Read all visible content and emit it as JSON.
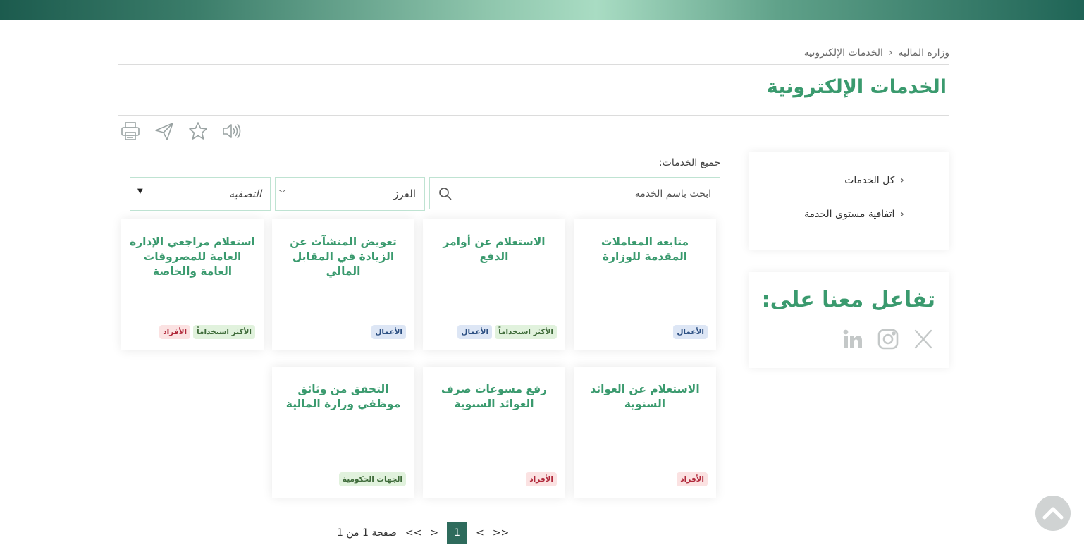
{
  "breadcrumb": {
    "home": "وزارة المالية",
    "current": "الخدمات الإلكترونية"
  },
  "page": {
    "title": "الخدمات الإلكترونية"
  },
  "tools": [
    "speaker-icon",
    "star-icon",
    "send-icon",
    "print-icon"
  ],
  "sidebar": {
    "items": [
      {
        "label": "كل الخدمات"
      },
      {
        "label": "اتفاقية مستوى الخدمة"
      }
    ]
  },
  "social": {
    "title": "تفاعل معنا على:",
    "icons": [
      "x-icon",
      "instagram-icon",
      "linkedin-icon"
    ]
  },
  "main": {
    "section_label": "جميع الخدمات:",
    "search_placeholder": "ابحث باسم الخدمة",
    "sort_label": "الفرز",
    "filter_label": "التصفيه"
  },
  "cards": [
    {
      "title": "متابعة المعاملات المقدمة للوزارة",
      "tags": [
        {
          "label": "الأعمال",
          "type": "business"
        }
      ]
    },
    {
      "title": "الاستعلام عن أوامر الدفع",
      "tags": [
        {
          "label": "الأكثر استخداماً",
          "type": "popular"
        },
        {
          "label": "الأعمال",
          "type": "business"
        }
      ]
    },
    {
      "title": "تعويض المنشآت عن الزيادة في المقابل المالي",
      "tags": [
        {
          "label": "الأعمال",
          "type": "business"
        }
      ]
    },
    {
      "title": "استعلام مراجعي الإدارة العامة للمصروفات العامة والخاصة",
      "tags": [
        {
          "label": "الأكثر استخداماً",
          "type": "popular"
        },
        {
          "label": "الأفراد",
          "type": "individuals"
        }
      ]
    },
    {
      "title": "الاستعلام عن العوائد السنوية",
      "tags": [
        {
          "label": "الأفراد",
          "type": "individuals"
        }
      ]
    },
    {
      "title": "رفع مسوغات صرف العوائد السنوية",
      "tags": [
        {
          "label": "الأفراد",
          "type": "individuals"
        }
      ]
    },
    {
      "title": "التحقق من وثائق موظفي وزارة المالية",
      "tags": [
        {
          "label": "الجهات الحكومية",
          "type": "gov"
        }
      ]
    }
  ],
  "pagination": {
    "info": "صفحة 1 من 1",
    "last": "<<",
    "next": ">",
    "current": "1",
    "prev": "<",
    "first": ">>"
  },
  "colors": {
    "brand_green": "#3a9a6e",
    "pager_active": "#2e6b5c"
  }
}
